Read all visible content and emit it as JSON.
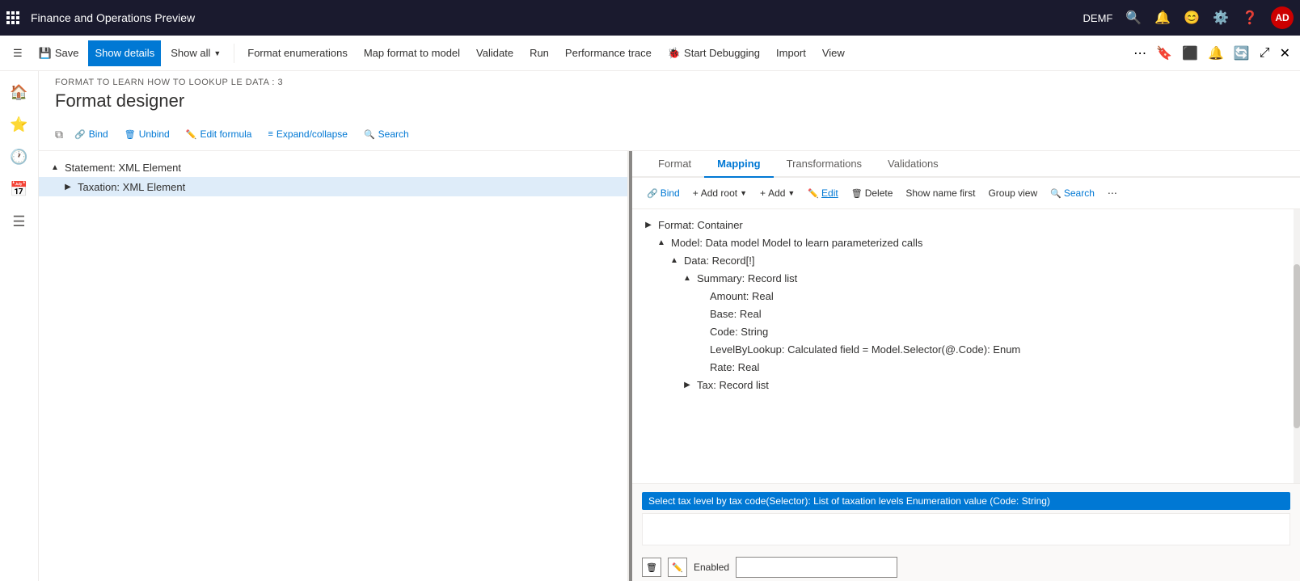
{
  "app": {
    "title": "Finance and Operations Preview",
    "tenant": "DEMF",
    "user_initials": "AD"
  },
  "commandbar": {
    "save": "Save",
    "show_details": "Show details",
    "show_all": "Show all",
    "format_enumerations": "Format enumerations",
    "map_format_to_model": "Map format to model",
    "validate": "Validate",
    "run": "Run",
    "performance_trace": "Performance trace",
    "start_debugging": "Start Debugging",
    "import": "Import",
    "view": "View"
  },
  "page": {
    "breadcrumb": "FORMAT TO LEARN HOW TO LOOKUP LE DATA : 3",
    "title": "Format designer"
  },
  "toolbar": {
    "bind": "Bind",
    "unbind": "Unbind",
    "edit_formula": "Edit formula",
    "expand_collapse": "Expand/collapse",
    "search": "Search"
  },
  "format_tree": {
    "items": [
      {
        "label": "Statement: XML Element",
        "level": 0,
        "expanded": true,
        "expand_char": "▲"
      },
      {
        "label": "Taxation: XML Element",
        "level": 1,
        "expanded": false,
        "expand_char": "▶",
        "selected": true
      }
    ]
  },
  "mapping_tabs": [
    {
      "label": "Format",
      "active": false
    },
    {
      "label": "Mapping",
      "active": true
    },
    {
      "label": "Transformations",
      "active": false
    },
    {
      "label": "Validations",
      "active": false
    }
  ],
  "mapping_toolbar": {
    "bind": "Bind",
    "add_root": "Add root",
    "add": "Add",
    "edit": "Edit",
    "delete": "Delete",
    "show_name_first": "Show name first",
    "group_view": "Group view",
    "search": "Search"
  },
  "mapping_tree": {
    "items": [
      {
        "label": "Format: Container",
        "level": 0,
        "expand": "▶",
        "indent": 0
      },
      {
        "label": "Model: Data model Model to learn parameterized calls",
        "level": 1,
        "expand": "▲",
        "indent": 1
      },
      {
        "label": "Data: Record[!]",
        "level": 2,
        "expand": "▲",
        "indent": 2
      },
      {
        "label": "Summary: Record list",
        "level": 3,
        "expand": "▲",
        "indent": 3
      },
      {
        "label": "Amount: Real",
        "level": 4,
        "expand": "",
        "indent": 4
      },
      {
        "label": "Base: Real",
        "level": 4,
        "expand": "",
        "indent": 4
      },
      {
        "label": "Code: String",
        "level": 4,
        "expand": "",
        "indent": 4
      },
      {
        "label": "LevelByLookup: Calculated field = Model.Selector(@.Code): Enum",
        "level": 4,
        "expand": "",
        "indent": 4
      },
      {
        "label": "Rate: Real",
        "level": 4,
        "expand": "",
        "indent": 4
      },
      {
        "label": "Tax: Record list",
        "level": 3,
        "expand": "▶",
        "indent": 3,
        "selected": false
      }
    ]
  },
  "formula": {
    "selected_text": "Select tax level by tax code(Selector): List of taxation levels Enumeration value (Code: String)",
    "input_value": "",
    "enabled_label": "Enabled",
    "enabled_value": ""
  }
}
